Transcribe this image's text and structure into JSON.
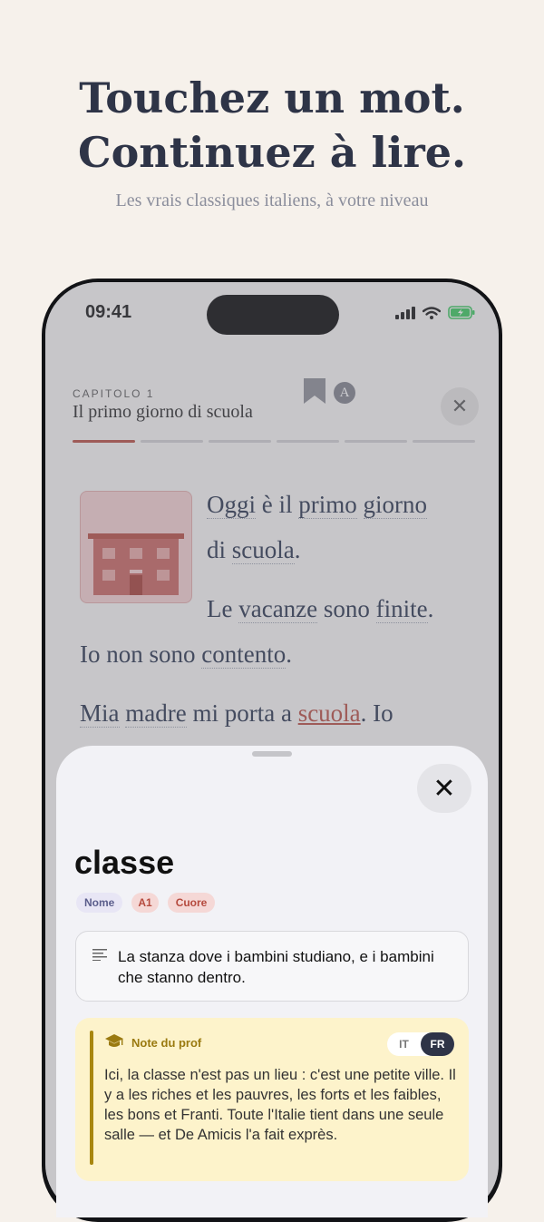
{
  "hero": {
    "line1": "Touchez un mot.",
    "line2": "Continuez à lire.",
    "subtitle": "Les vrais classiques italiens, à votre niveau"
  },
  "status": {
    "time": "09:41"
  },
  "reader": {
    "chapter_label": "CAPITOLO 1",
    "chapter_title": "Il primo giorno di scuola",
    "close_glyph": "✕",
    "font_glyph": "A",
    "progress_total": 6,
    "progress_active": 1,
    "text": {
      "l1_w1": "Oggi",
      "l1_mid": " è il ",
      "l1_w2": "primo",
      "l1_w3": "giorno",
      "l2_pre": "di ",
      "l2_w": "scuola",
      "l2_end": ".",
      "l3_pre": "Le ",
      "l3_w1": "vacanze",
      "l3_mid": " sono ",
      "l3_w2": "finite",
      "l3_end": ".",
      "l4_pre": "Io non sono ",
      "l4_w": "contento",
      "l4_end": ".",
      "l5_w1": "Mia",
      "l5_sp1": " ",
      "l5_w2": "madre",
      "l5_mid": " mi porta a ",
      "l5_hl": "scuola",
      "l5_end": ". Io"
    }
  },
  "sheet": {
    "close_glyph": "✕",
    "word": "classe",
    "tags": {
      "pos": "Nome",
      "level": "A1",
      "book": "Cuore"
    },
    "definition": "La stanza dove i bambini studiano, e i bambini che stanno dentro.",
    "note": {
      "title": "Note du prof",
      "lang_it": "IT",
      "lang_fr": "FR",
      "selected_lang": "FR",
      "text": "Ici, la classe n'est pas un lieu : c'est une petite ville. Il y a les riches et les pauvres, les forts et les faibles, les bons et Franti. Toute l'Italie tient dans une seule salle — et De Amicis l'a fait exprès."
    }
  },
  "colors": {
    "accent": "#b54a3e",
    "ink": "#2e3447",
    "note_gold": "#a8860f"
  }
}
